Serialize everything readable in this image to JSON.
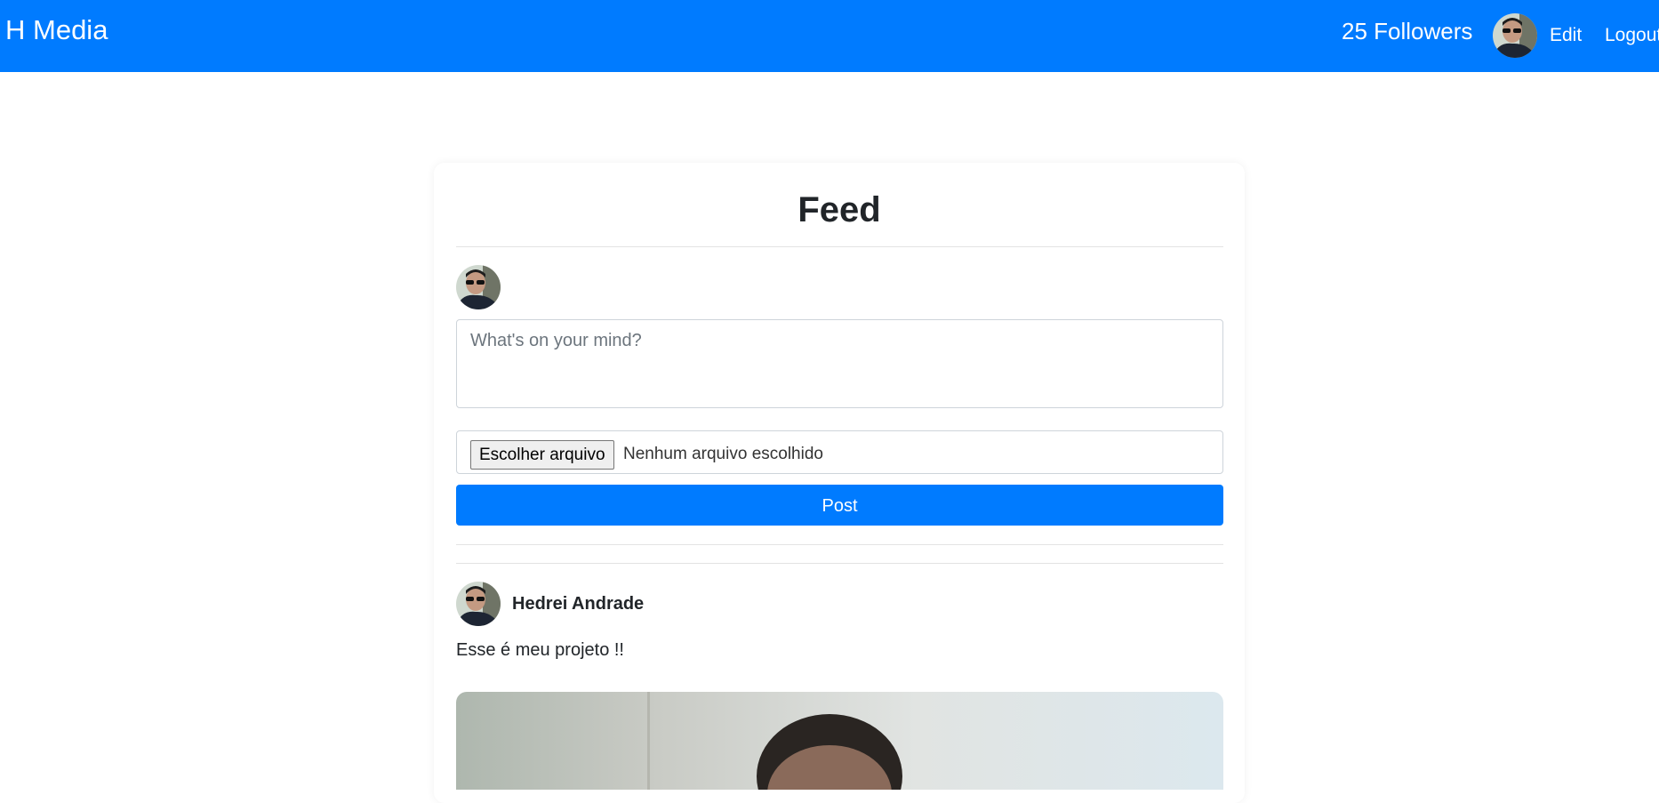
{
  "navbar": {
    "brand": "H Media",
    "followers": "25 Followers",
    "edit_label": "Edit",
    "logout_label": "Logout",
    "background": "#007bff"
  },
  "feed": {
    "title": "Feed",
    "composer": {
      "placeholder": "What's on your mind?",
      "file_button_label": "Escolher arquivo",
      "file_status": "Nenhum arquivo escolhido",
      "post_button_label": "Post"
    },
    "posts": [
      {
        "author": "Hedrei Andrade",
        "text": "Esse é meu projeto !!"
      }
    ]
  },
  "icons": {
    "avatar": "avatar-photo",
    "post_image": "post-photo"
  }
}
